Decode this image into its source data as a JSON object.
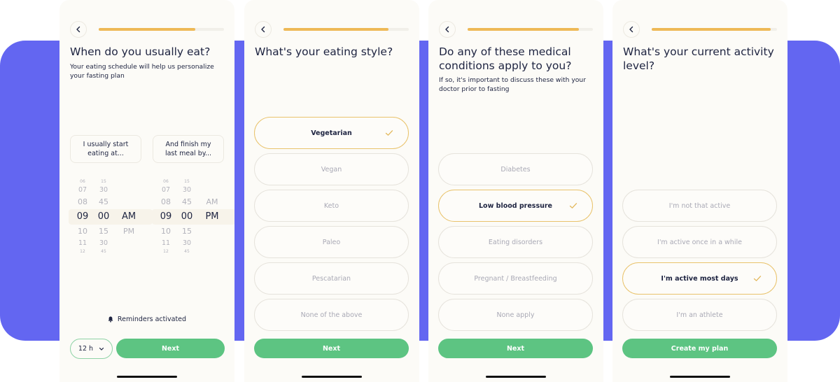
{
  "colors": {
    "band": "#6366f1",
    "progress": "#eeb957",
    "primary_button": "#5dc482",
    "selected_border": "#e9c36c"
  },
  "screens": [
    {
      "progress": 0.77,
      "title": "When do you usually eat?",
      "subtitle": "Your eating schedule will help us personalize your fasting plan",
      "start_label": "I usually start eating at...",
      "end_label": "And finish my last meal by...",
      "start_picker": {
        "hours": [
          "06",
          "07",
          "08",
          "09",
          "10",
          "11",
          "12"
        ],
        "minutes": [
          "15",
          "30",
          "45",
          "00",
          "15",
          "30",
          "45"
        ],
        "periods": [
          "AM",
          "PM"
        ],
        "selected_hour": "09",
        "selected_minute": "00",
        "selected_period": "AM"
      },
      "end_picker": {
        "hours": [
          "06",
          "07",
          "08",
          "09",
          "10",
          "11",
          "12"
        ],
        "minutes": [
          "15",
          "30",
          "45",
          "00",
          "15",
          "30",
          "45"
        ],
        "periods": [
          "AM",
          "PM"
        ],
        "selected_hour": "09",
        "selected_minute": "00",
        "selected_period": "PM"
      },
      "reminder_text": "Reminders activated",
      "format_value": "12 h",
      "button_label": "Next"
    },
    {
      "progress": 0.84,
      "title": "What's your eating style?",
      "options": [
        {
          "label": "Vegetarian",
          "selected": true
        },
        {
          "label": "Vegan",
          "selected": false
        },
        {
          "label": "Keto",
          "selected": false
        },
        {
          "label": "Paleo",
          "selected": false
        },
        {
          "label": "Pescatarian",
          "selected": false
        },
        {
          "label": "None of the above",
          "selected": false
        }
      ],
      "button_label": "Next"
    },
    {
      "progress": 0.89,
      "title": "Do any of these medical conditions apply to you?",
      "subtitle": "If so, it's important to discuss these with your doctor prior to fasting",
      "options": [
        {
          "label": "Diabetes",
          "selected": false
        },
        {
          "label": "Low blood pressure",
          "selected": true
        },
        {
          "label": "Eating disorders",
          "selected": false
        },
        {
          "label": "Pregnant / Breastfeeding",
          "selected": false
        },
        {
          "label": "None apply",
          "selected": false
        }
      ],
      "button_label": "Next"
    },
    {
      "progress": 0.95,
      "title": "What's your current activity level?",
      "options": [
        {
          "label": "I'm not that active",
          "selected": false
        },
        {
          "label": "I'm active once in a while",
          "selected": false
        },
        {
          "label": "I'm active most days",
          "selected": true
        },
        {
          "label": "I'm an athlete",
          "selected": false
        }
      ],
      "button_label": "Create my plan"
    }
  ]
}
